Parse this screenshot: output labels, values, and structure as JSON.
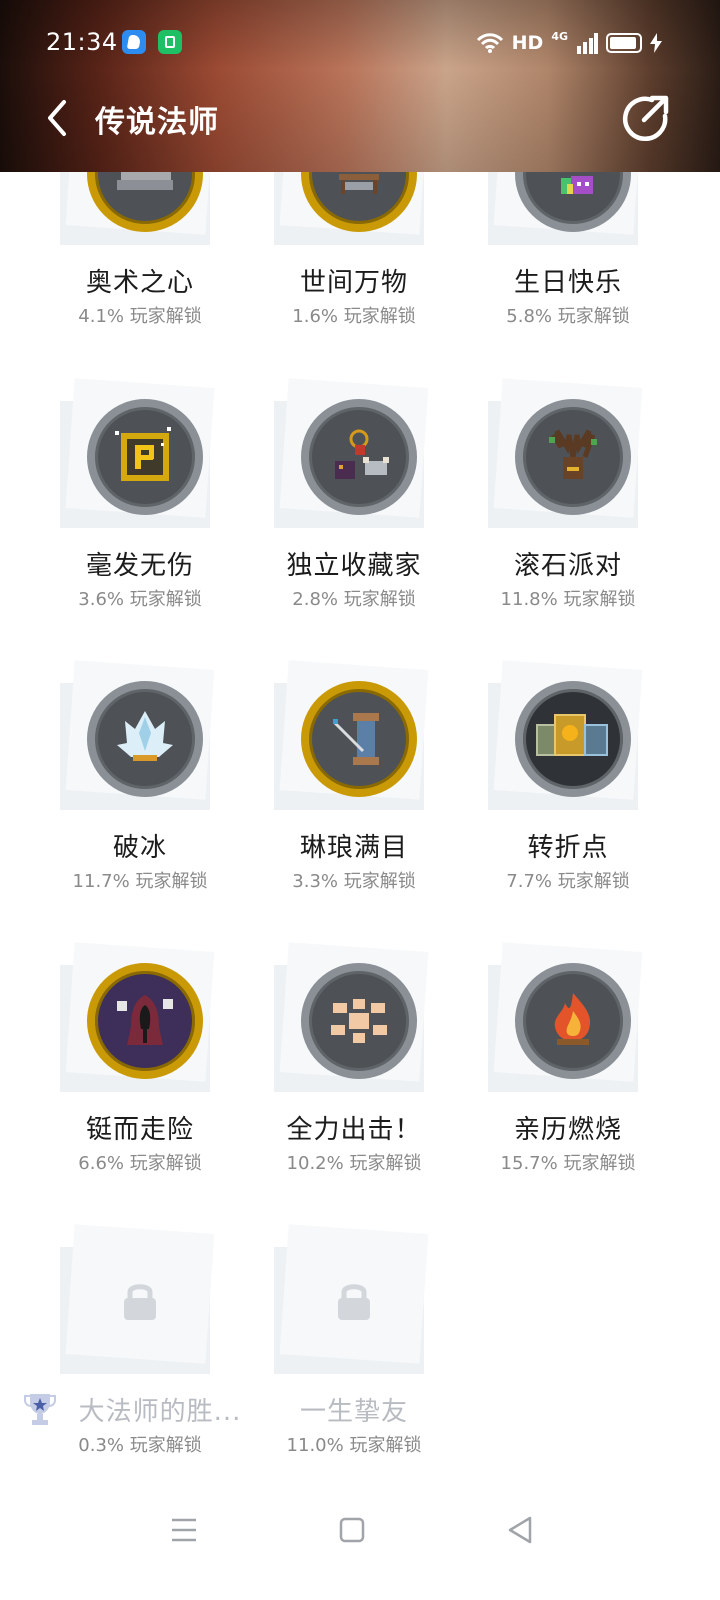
{
  "status_bar": {
    "time": "21:34",
    "network_type": "HD",
    "signal_label": "4G"
  },
  "header": {
    "title": "传说法师",
    "back_icon": "chevron-left-icon",
    "share_icon": "share-icon"
  },
  "achievements": [
    {
      "name": "奥术之心",
      "rate": "4.1% 玩家解锁",
      "frame": "gold",
      "icon": "scrolls-icon"
    },
    {
      "name": "世间万物",
      "rate": "1.6% 玩家解锁",
      "frame": "gold",
      "icon": "bookshelf-icon"
    },
    {
      "name": "生日快乐",
      "rate": "5.8% 玩家解锁",
      "frame": "silver",
      "icon": "gift-monster-icon"
    },
    {
      "name": "毫发无伤",
      "rate": "3.6% 玩家解锁",
      "frame": "silver",
      "icon": "p-sign-icon"
    },
    {
      "name": "独立收藏家",
      "rate": "2.8% 玩家解锁",
      "frame": "silver",
      "icon": "relics-icon"
    },
    {
      "name": "滚石派对",
      "rate": "11.8% 玩家解锁",
      "frame": "silver",
      "icon": "antler-mask-icon"
    },
    {
      "name": "破冰",
      "rate": "11.7% 玩家解锁",
      "frame": "silver",
      "icon": "ice-crystal-icon"
    },
    {
      "name": "琳琅满目",
      "rate": "3.3% 玩家解锁",
      "frame": "gold",
      "icon": "thread-spool-icon"
    },
    {
      "name": "转折点",
      "rate": "7.7% 玩家解锁",
      "frame": "silver",
      "icon": "cards-icon"
    },
    {
      "name": "铤而走险",
      "rate": "6.6% 玩家解锁",
      "frame": "gold",
      "icon": "hooded-figure-icon"
    },
    {
      "name": "全力出击！",
      "rate": "10.2% 玩家解锁",
      "frame": "silver",
      "icon": "fists-icon"
    },
    {
      "name": "亲历燃烧",
      "rate": "15.7% 玩家解锁",
      "frame": "silver",
      "icon": "campfire-icon"
    },
    {
      "name": "大法师的胜...",
      "rate": "0.3% 玩家解锁",
      "frame": "locked",
      "icon": "lock-icon",
      "tag_icon": "trophy-icon"
    },
    {
      "name": "一生挚友",
      "rate": "11.0% 玩家解锁",
      "frame": "locked",
      "icon": "lock-icon"
    }
  ],
  "nav_bar": {
    "menu_icon": "menu-icon",
    "home_icon": "home-square-icon",
    "back_icon": "back-triangle-icon"
  },
  "colors": {
    "gold_frame": "#c99a06",
    "silver_frame": "#8a9096",
    "badge_fill": "#4e5257",
    "rate_text": "#8a8a8a",
    "locked_text": "#b8bcc2"
  }
}
